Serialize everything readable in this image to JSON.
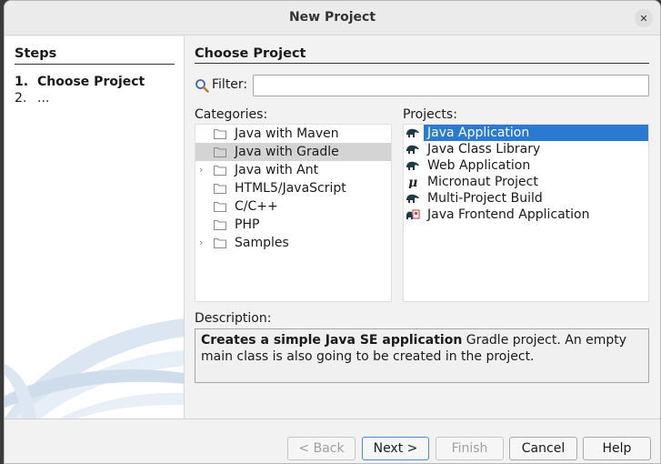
{
  "window": {
    "title": "New Project",
    "close_glyph": "✕"
  },
  "steps": {
    "title": "Steps",
    "items": [
      {
        "num": "1.",
        "label": "Choose Project"
      },
      {
        "num": "2.",
        "label": "..."
      }
    ]
  },
  "main": {
    "section_title": "Choose Project",
    "filter": {
      "label": "Filter:",
      "value": "",
      "placeholder": ""
    },
    "categories_label": "Categories:",
    "projects_label": "Projects:",
    "categories": [
      {
        "label": "Java with Maven",
        "expandable": false,
        "selected": false
      },
      {
        "label": "Java with Gradle",
        "expandable": false,
        "selected": true
      },
      {
        "label": "Java with Ant",
        "expandable": true,
        "selected": false
      },
      {
        "label": "HTML5/JavaScript",
        "expandable": false,
        "selected": false
      },
      {
        "label": "C/C++",
        "expandable": false,
        "selected": false
      },
      {
        "label": "PHP",
        "expandable": false,
        "selected": false
      },
      {
        "label": "Samples",
        "expandable": true,
        "selected": false
      }
    ],
    "projects": [
      {
        "label": "Java Application",
        "icon": "gradle-elephant-icon",
        "selected": true
      },
      {
        "label": "Java Class Library",
        "icon": "gradle-elephant-icon",
        "selected": false
      },
      {
        "label": "Web Application",
        "icon": "gradle-elephant-icon",
        "selected": false
      },
      {
        "label": "Micronaut Project",
        "icon": "micronaut-mu-icon",
        "selected": false
      },
      {
        "label": "Multi-Project Build",
        "icon": "gradle-elephant-icon",
        "selected": false
      },
      {
        "label": "Java Frontend Application",
        "icon": "frontend-app-icon",
        "selected": false
      }
    ],
    "description_label": "Description:",
    "description_bold": "Creates a simple Java SE application",
    "description_rest": " Gradle project. An empty main class is also going to be created in the project."
  },
  "buttons": {
    "back": "< Back",
    "next": "Next >",
    "finish": "Finish",
    "cancel": "Cancel",
    "help": "Help"
  },
  "colors": {
    "selection": "#2a7ad4",
    "category_selection": "#d4d4d4"
  }
}
